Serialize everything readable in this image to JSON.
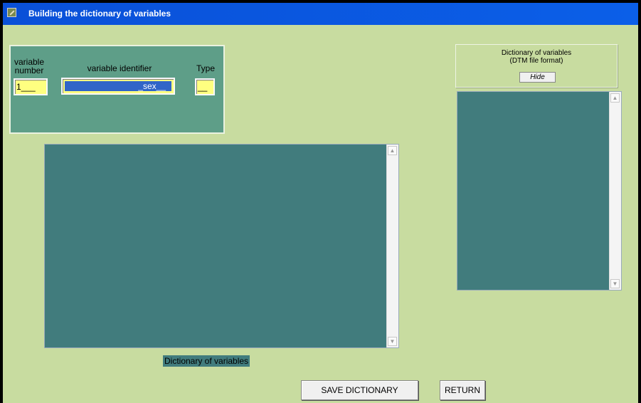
{
  "window": {
    "title": "Building the dictionary of variables"
  },
  "entry_panel": {
    "variable_number_label_line1": "variable",
    "variable_number_label_line2": "number",
    "variable_number_value": "1___",
    "variable_identifier_label": "variable identifier",
    "variable_identifier_value": "_sex__",
    "type_label": "Type",
    "type_value": "__"
  },
  "dictionary_list": {
    "caption": "Dictionary of variables"
  },
  "dtm_panel": {
    "title_line1": "Dictionary of variables",
    "title_line2": "(DTM file format)",
    "hide_label": "Hide"
  },
  "buttons": {
    "save_label": "SAVE DICTIONARY",
    "return_label": "RETURN"
  },
  "icons": {
    "app_icon": "app-pen-icon",
    "scroll_up": "chevron-up-icon",
    "scroll_down": "chevron-down-icon"
  },
  "colors": {
    "background": "#c8dca0",
    "panel": "#5e9e88",
    "listbox": "#417c7d",
    "field": "#ffff80",
    "selection": "#3165c8",
    "titlebar": "#0a50d8"
  }
}
